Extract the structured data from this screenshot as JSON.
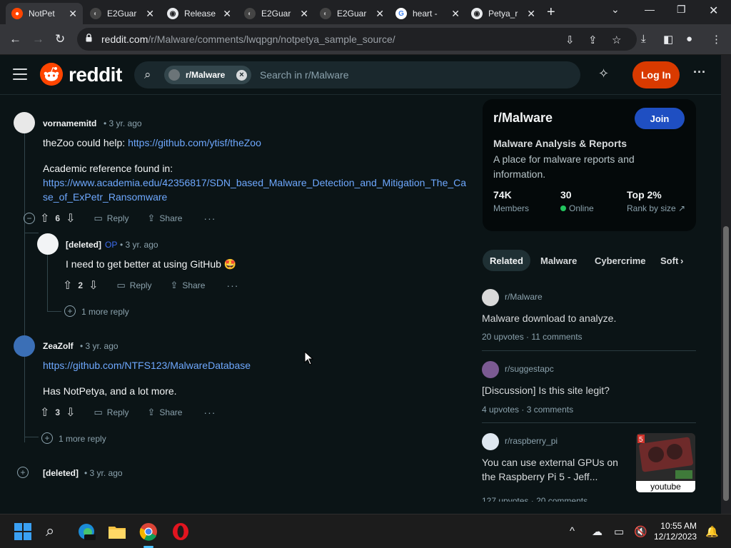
{
  "browser": {
    "tabs": [
      {
        "label": "NotPet",
        "favicon": "reddit-icon"
      },
      {
        "label": "E2Guar",
        "favicon": "e2guardian-icon"
      },
      {
        "label": "Release",
        "favicon": "github-icon"
      },
      {
        "label": "E2Guar",
        "favicon": "e2guardian-icon"
      },
      {
        "label": "E2Guar",
        "favicon": "e2guardian-icon"
      },
      {
        "label": "heart -",
        "favicon": "google-icon"
      },
      {
        "label": "Petya_r",
        "favicon": "github-icon"
      }
    ],
    "url_host": "reddit.com",
    "url_path": "/r/Malware/comments/lwqpgn/notpetya_sample_source/"
  },
  "header": {
    "logo_text": "reddit",
    "search_chip": "r/Malware",
    "search_placeholder": "Search in r/Malware",
    "login_label": "Log In"
  },
  "comments": [
    {
      "user": "vornamemitd",
      "meta": "• 3 yr. ago",
      "text1_prefix": "theZoo could help: ",
      "text1_link": "https://github.com/ytisf/theZoo",
      "text2": "Academic reference found in:",
      "link2_line1": "https://www.academia.edu/42356817/SDN_based_Malware_Detection_and_Mitigation_The_Ca",
      "link2_line2": "se_of_ExPetr_Ransomware",
      "score": "6"
    },
    {
      "user": "[deleted]",
      "op": "OP",
      "meta": "• 3 yr. ago",
      "text": "I need to get better at using GitHub 🤩",
      "score": "2",
      "more_reply": "1 more reply"
    },
    {
      "user": "ZeaZolf",
      "meta": "• 3 yr. ago",
      "link": "https://github.com/NTFS123/MalwareDatabase",
      "text": "Has NotPetya, and a lot more.",
      "score": "3",
      "more_reply": "1 more reply"
    },
    {
      "user": "[deleted]",
      "meta": "• 3 yr. ago"
    }
  ],
  "actions": {
    "reply": "Reply",
    "share": "Share"
  },
  "sidebar": {
    "sub_name": "r/Malware",
    "join_label": "Join",
    "headline": "Malware Analysis & Reports",
    "description": "A place for malware reports and information.",
    "stats": [
      {
        "value": "74K",
        "label": "Members"
      },
      {
        "value": "30",
        "label": "Online"
      },
      {
        "value": "Top 2%",
        "label": "Rank by size"
      }
    ],
    "related_tabs": [
      "Related",
      "Malware",
      "Cybercrime",
      "Soft"
    ],
    "posts": [
      {
        "sub": "r/Malware",
        "title": "Malware download to analyze.",
        "upvotes": "20 upvotes",
        "comments": "11 comments"
      },
      {
        "sub": "r/suggestapc",
        "title": "[Discussion] Is this site legit?",
        "upvotes": "4 upvotes",
        "comments": "3 comments"
      },
      {
        "sub": "r/raspberry_pi",
        "title_line1": "You can use external GPUs on",
        "title_line2": "the Raspberry Pi 5 - Jeff...",
        "upvotes": "127 upvotes",
        "comments": "20 comments",
        "thumb_label": "youtube",
        "thumb_badge": "5"
      }
    ]
  },
  "taskbar": {
    "time": "10:55 AM",
    "date": "12/12/2023"
  },
  "colors": {
    "bg": "#0b1416",
    "reddit_orange": "#ff4500",
    "login": "#d93a00",
    "join": "#1f4fc2",
    "link": "#6ea8fe"
  }
}
